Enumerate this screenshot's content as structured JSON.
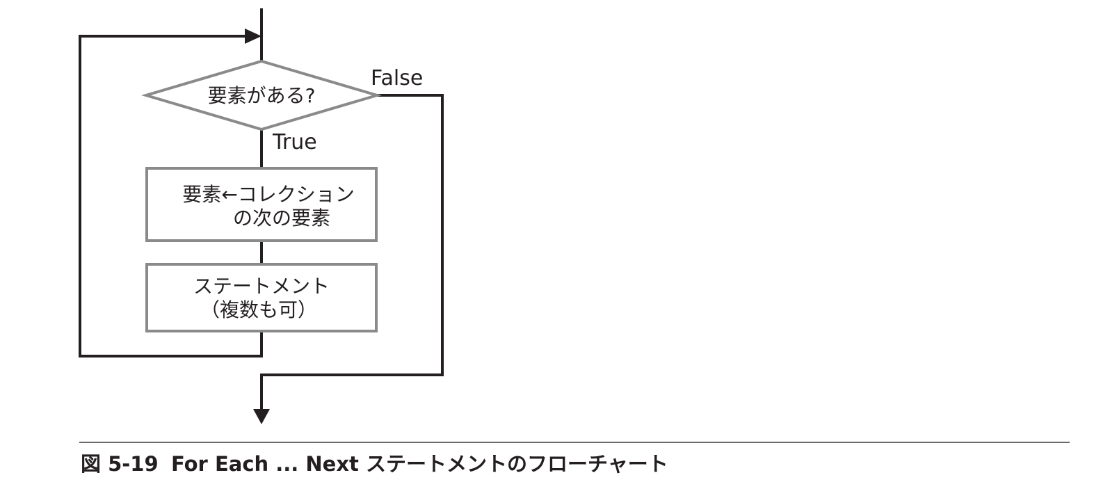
{
  "flowchart": {
    "decision": {
      "label": "要素がある?"
    },
    "branches": {
      "true_label": "True",
      "false_label": "False"
    },
    "process_next": {
      "line1": "要素←コレクション",
      "line2": "の次の要素"
    },
    "process_statement": {
      "line1": "ステートメント",
      "line2": "（複数も可）"
    }
  },
  "caption": {
    "number": "図 5-19",
    "title": "For Each ... Next ステートメントのフローチャート"
  },
  "colors": {
    "line": "#231f20",
    "shape_border": "#8a8a8a",
    "caption_rule": "#6b6b6b"
  }
}
